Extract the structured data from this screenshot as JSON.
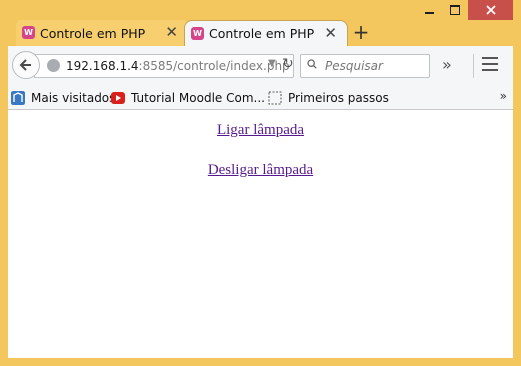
{
  "window": {
    "controls": {
      "minimize": "minimize-icon",
      "maximize": "maximize-icon",
      "close": "close-icon"
    },
    "colors": {
      "frame": "#f3c65e",
      "close_button": "#c7504b",
      "link": "#551a8b"
    }
  },
  "tabs": [
    {
      "title": "Controle em PHP",
      "favicon": "wamp-icon",
      "active": false
    },
    {
      "title": "Controle em PHP",
      "favicon": "wamp-icon",
      "active": true
    }
  ],
  "toolbar": {
    "url_host": "192.168.1.4",
    "url_rest": ":8585/controle/index.php",
    "search_placeholder": "Pesquisar"
  },
  "bookmarks": [
    {
      "label": "Mais visitados",
      "icon": "bookmark-star-icon"
    },
    {
      "label": "Tutorial Moodle Com...",
      "icon": "youtube-icon"
    },
    {
      "label": "Primeiros passos",
      "icon": "page-icon"
    }
  ],
  "content": {
    "links": [
      "Ligar lâmpada",
      "Desligar lâmpada"
    ]
  }
}
